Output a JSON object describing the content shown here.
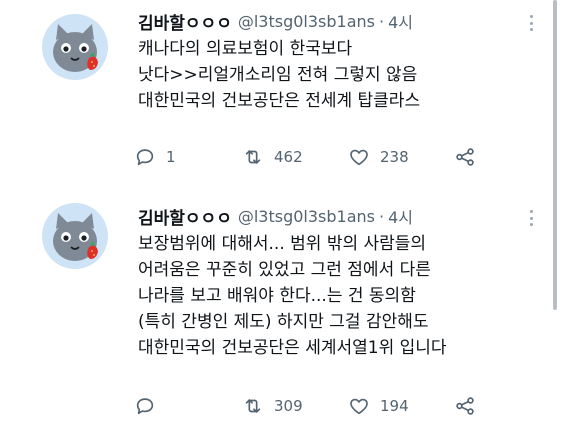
{
  "colors": {
    "text": "#0f1419",
    "muted": "#536471",
    "avatar_bg": "#cfe3f6",
    "cat": "#7f8a96",
    "strawberry": "#e0302a"
  },
  "tweets": [
    {
      "author_name": "김바할ㅇㅇㅇ",
      "handle": "@l3tsg0l3sb1ans",
      "separator": "·",
      "time": "4시",
      "lines": [
        "캐나다의 의료보험이 한국보다",
        "낫다>>리얼개소리임 전혀 그렇지 않음",
        "대한민국의 건보공단은 전세계 탑클라스"
      ],
      "reply_count": "1",
      "retweet_count": "462",
      "like_count": "238"
    },
    {
      "author_name": "김바할ㅇㅇㅇ",
      "handle": "@l3tsg0l3sb1ans",
      "separator": "·",
      "time": "4시",
      "lines": [
        "보장범위에 대해서... 범위 밖의 사람들의",
        "어려움은 꾸준히 있었고 그런 점에서 다른",
        "나라를 보고 배워야 한다...는 건 동의함",
        "(특히 간병인 제도) 하지만 그걸 감안해도",
        "대한민국의 건보공단은 세계서열1위 입니다"
      ],
      "reply_count": "",
      "retweet_count": "309",
      "like_count": "194"
    }
  ],
  "icons": {
    "avatar": "gray-cat-with-strawberry-icon",
    "more": "more-dots-icon",
    "reply": "reply-icon",
    "retweet": "retweet-icon",
    "like": "heart-icon",
    "share": "share-icon"
  }
}
